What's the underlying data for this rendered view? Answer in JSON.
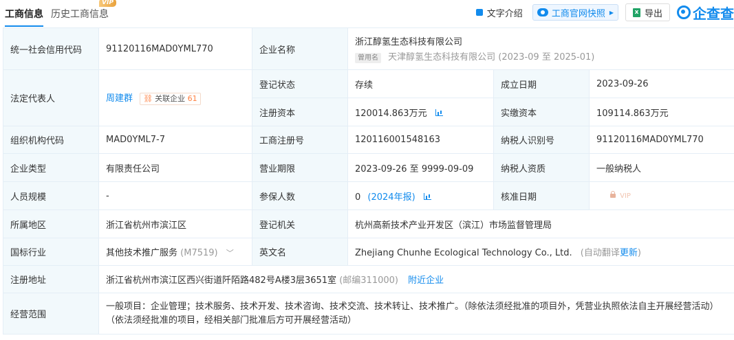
{
  "tabs": {
    "active": "工商信息",
    "history": "历史工商信息",
    "vip_badge": "VIP"
  },
  "toolbar": {
    "intro": "文字介绍",
    "snapshot": "工商官网快照",
    "export": "导出",
    "brand": "企查查"
  },
  "labels": {
    "credit_code": "统一社会信用代码",
    "company_name": "企业名称",
    "legal_rep": "法定代表人",
    "reg_status": "登记状态",
    "established": "成立日期",
    "reg_capital": "注册资本",
    "paid_capital": "实缴资本",
    "org_code": "组织机构代码",
    "reg_number": "工商注册号",
    "taxpayer_id": "纳税人识别号",
    "company_type": "企业类型",
    "business_term": "营业期限",
    "taxpayer_qual": "纳税人资质",
    "staff_size": "人员规模",
    "insured": "参保人数",
    "approval_date": "核准日期",
    "region": "所属地区",
    "reg_authority": "登记机关",
    "industry": "国标行业",
    "english_name": "英文名",
    "reg_address": "注册地址",
    "scope": "经营范围"
  },
  "values": {
    "credit_code": "91120116MAD0YML770",
    "company_name": "浙江醇氢生态科技有限公司",
    "former_tag": "曾用名",
    "former_name": "天津醇氢生态科技有限公司",
    "former_period": "(2023-09 至 2025-01)",
    "legal_rep": "周建群",
    "related_tag": "关联企业",
    "related_count": "61",
    "reg_status": "存续",
    "established": "2023-09-26",
    "reg_capital": "120014.863万元",
    "paid_capital": "109114.863万元",
    "org_code": "MAD0YML7-7",
    "reg_number": "120116001548163",
    "taxpayer_id": "91120116MAD0YML770",
    "company_type": "有限责任公司",
    "business_term": "2023-09-26 至 9999-09-09",
    "taxpayer_qual": "一般纳税人",
    "staff_size": "-",
    "insured": "0",
    "insured_report": "(2024年报)",
    "approval_vip": "VIP",
    "region": "浙江省杭州市滨江区",
    "reg_authority": "杭州高新技术产业开发区（滨江）市场监督管理局",
    "industry": "其他技术推广服务",
    "industry_code": "(M7519)",
    "english_name": "Zhejiang Chunhe Ecological Technology Co., Ltd.",
    "auto_translate": "(自动翻译",
    "update": "更新",
    "update_close": ")",
    "reg_address": "浙江省杭州市滨江区西兴街道阡陌路482号A楼3层3651室",
    "postcode": "(邮编311000)",
    "nearby": "附近企业",
    "scope": "一般项目：企业管理；技术服务、技术开发、技术咨询、技术交流、技术转让、技术推广。（除依法须经批准的项目外，凭营业执照依法自主开展经营活动）（依法须经批准的项目，经相关部门批准后方可开展经营活动）"
  }
}
